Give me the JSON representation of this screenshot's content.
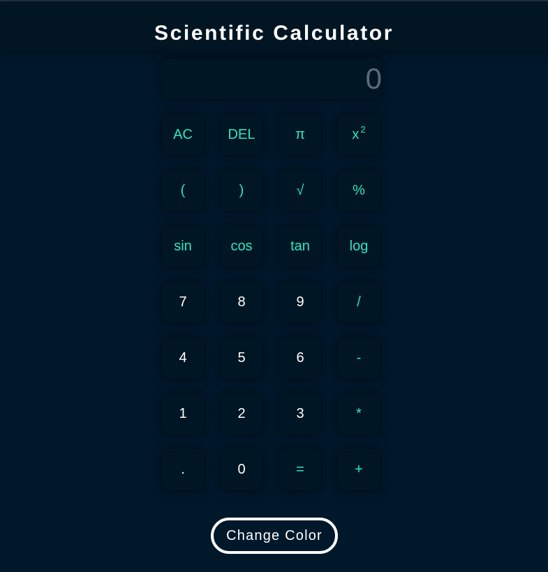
{
  "header": {
    "title": "Scientific Calculator"
  },
  "display": {
    "value": "0"
  },
  "keypad": {
    "rows": [
      [
        {
          "label": "AC",
          "name": "clear-button",
          "accent": "teal"
        },
        {
          "label": "DEL",
          "name": "delete-button",
          "accent": "teal"
        },
        {
          "label": "π",
          "name": "pi-button",
          "accent": "teal"
        },
        {
          "label": "x",
          "sup": "2",
          "name": "square-button",
          "accent": "teal"
        }
      ],
      [
        {
          "label": "(",
          "name": "open-paren-button",
          "accent": "teal"
        },
        {
          "label": ")",
          "name": "close-paren-button",
          "accent": "teal"
        },
        {
          "label": "√",
          "name": "sqrt-button",
          "accent": "teal"
        },
        {
          "label": "%",
          "name": "percent-button",
          "accent": "teal"
        }
      ],
      [
        {
          "label": "sin",
          "name": "sin-button",
          "accent": "teal"
        },
        {
          "label": "cos",
          "name": "cos-button",
          "accent": "teal"
        },
        {
          "label": "tan",
          "name": "tan-button",
          "accent": "teal"
        },
        {
          "label": "log",
          "name": "log-button",
          "accent": "teal"
        }
      ],
      [
        {
          "label": "7",
          "name": "digit-7-button",
          "accent": "white"
        },
        {
          "label": "8",
          "name": "digit-8-button",
          "accent": "white"
        },
        {
          "label": "9",
          "name": "digit-9-button",
          "accent": "white"
        },
        {
          "label": "/",
          "name": "divide-button",
          "accent": "teal"
        }
      ],
      [
        {
          "label": "4",
          "name": "digit-4-button",
          "accent": "white"
        },
        {
          "label": "5",
          "name": "digit-5-button",
          "accent": "white"
        },
        {
          "label": "6",
          "name": "digit-6-button",
          "accent": "white"
        },
        {
          "label": "-",
          "name": "subtract-button",
          "accent": "teal"
        }
      ],
      [
        {
          "label": "1",
          "name": "digit-1-button",
          "accent": "white"
        },
        {
          "label": "2",
          "name": "digit-2-button",
          "accent": "white"
        },
        {
          "label": "3",
          "name": "digit-3-button",
          "accent": "white"
        },
        {
          "label": "*",
          "name": "multiply-button",
          "accent": "teal"
        }
      ],
      [
        {
          "label": ".",
          "name": "decimal-button",
          "accent": "white"
        },
        {
          "label": "0",
          "name": "digit-0-button",
          "accent": "white"
        },
        {
          "label": "=",
          "name": "equals-button",
          "accent": "teal"
        },
        {
          "label": "+",
          "name": "add-button",
          "accent": "teal"
        }
      ]
    ]
  },
  "footer": {
    "change_color_label": "Change Color"
  },
  "colors": {
    "background": "#01182b",
    "accent": "#2ee6c2",
    "display_text": "#5c6b76"
  }
}
